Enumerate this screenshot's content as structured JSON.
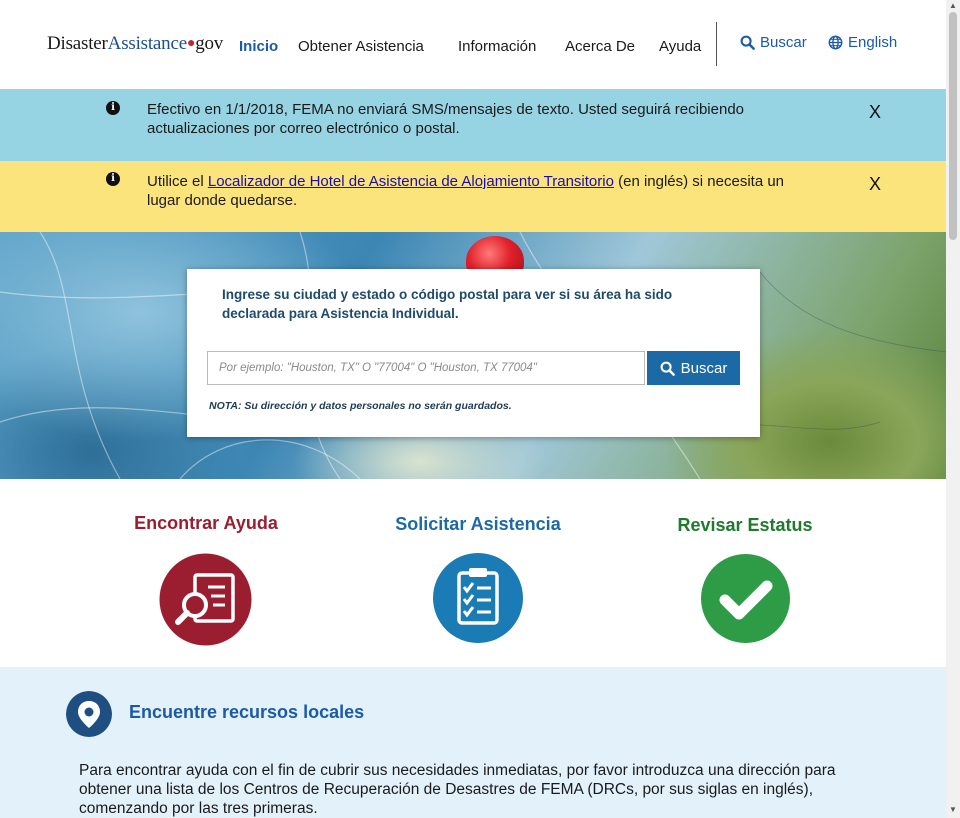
{
  "header": {
    "logo": {
      "part1": "Disaster",
      "part2": "Assistance",
      "dot": "●",
      "part3": "gov"
    },
    "nav": [
      {
        "label": "Inicio",
        "active": true
      },
      {
        "label": "Obtener Asistencia"
      },
      {
        "label": "Información"
      },
      {
        "label": "Acerca De"
      },
      {
        "label": "Ayuda"
      }
    ],
    "search_link": "Buscar",
    "language_link": "English"
  },
  "alerts": {
    "sms": {
      "text": "Efectivo en 1/1/2018, FEMA no enviará SMS/mensajes de texto. Usted seguirá recibiendo actualizaciones por correo electrónico o postal.",
      "close": "X",
      "color": "#97d4e3"
    },
    "hotel": {
      "before": "Utilice el ",
      "link": "Localizador de Hotel de Asistencia de Alojamiento Transitorio",
      "after": " (en inglés) si necesita un lugar donde quedarse.",
      "close": "X",
      "color": "#fbe47b"
    }
  },
  "hero_search": {
    "heading": "Ingrese su ciudad y estado o código postal para ver si su área ha sido declarada para Asistencia Individual.",
    "placeholder": "Por ejemplo: \"Houston, TX\" O \"77004\" O \"Houston, TX 77004\"",
    "button": "Buscar",
    "note": "NOTA: Su dirección y datos personales no serán guardados."
  },
  "features": [
    {
      "title": "Encontrar Ayuda",
      "icon": "document-magnifier-icon",
      "color": "#9b1e30"
    },
    {
      "title": "Solicitar Asistencia",
      "icon": "clipboard-checklist-icon",
      "color": "#1b6aa5"
    },
    {
      "title": "Revisar Estatus",
      "icon": "checkmark-icon",
      "color": "#2e9b47"
    }
  ],
  "resources": {
    "icon": "location-pin-icon",
    "title": "Encuentre recursos locales",
    "text": "Para encontrar ayuda con el fin de cubrir sus necesidades inmediatas, por favor introduzca una dirección para obtener una lista de los Centros de Recuperación de Desastres de FEMA (DRCs, por sus siglas en inglés), comenzando por las tres primeras."
  }
}
